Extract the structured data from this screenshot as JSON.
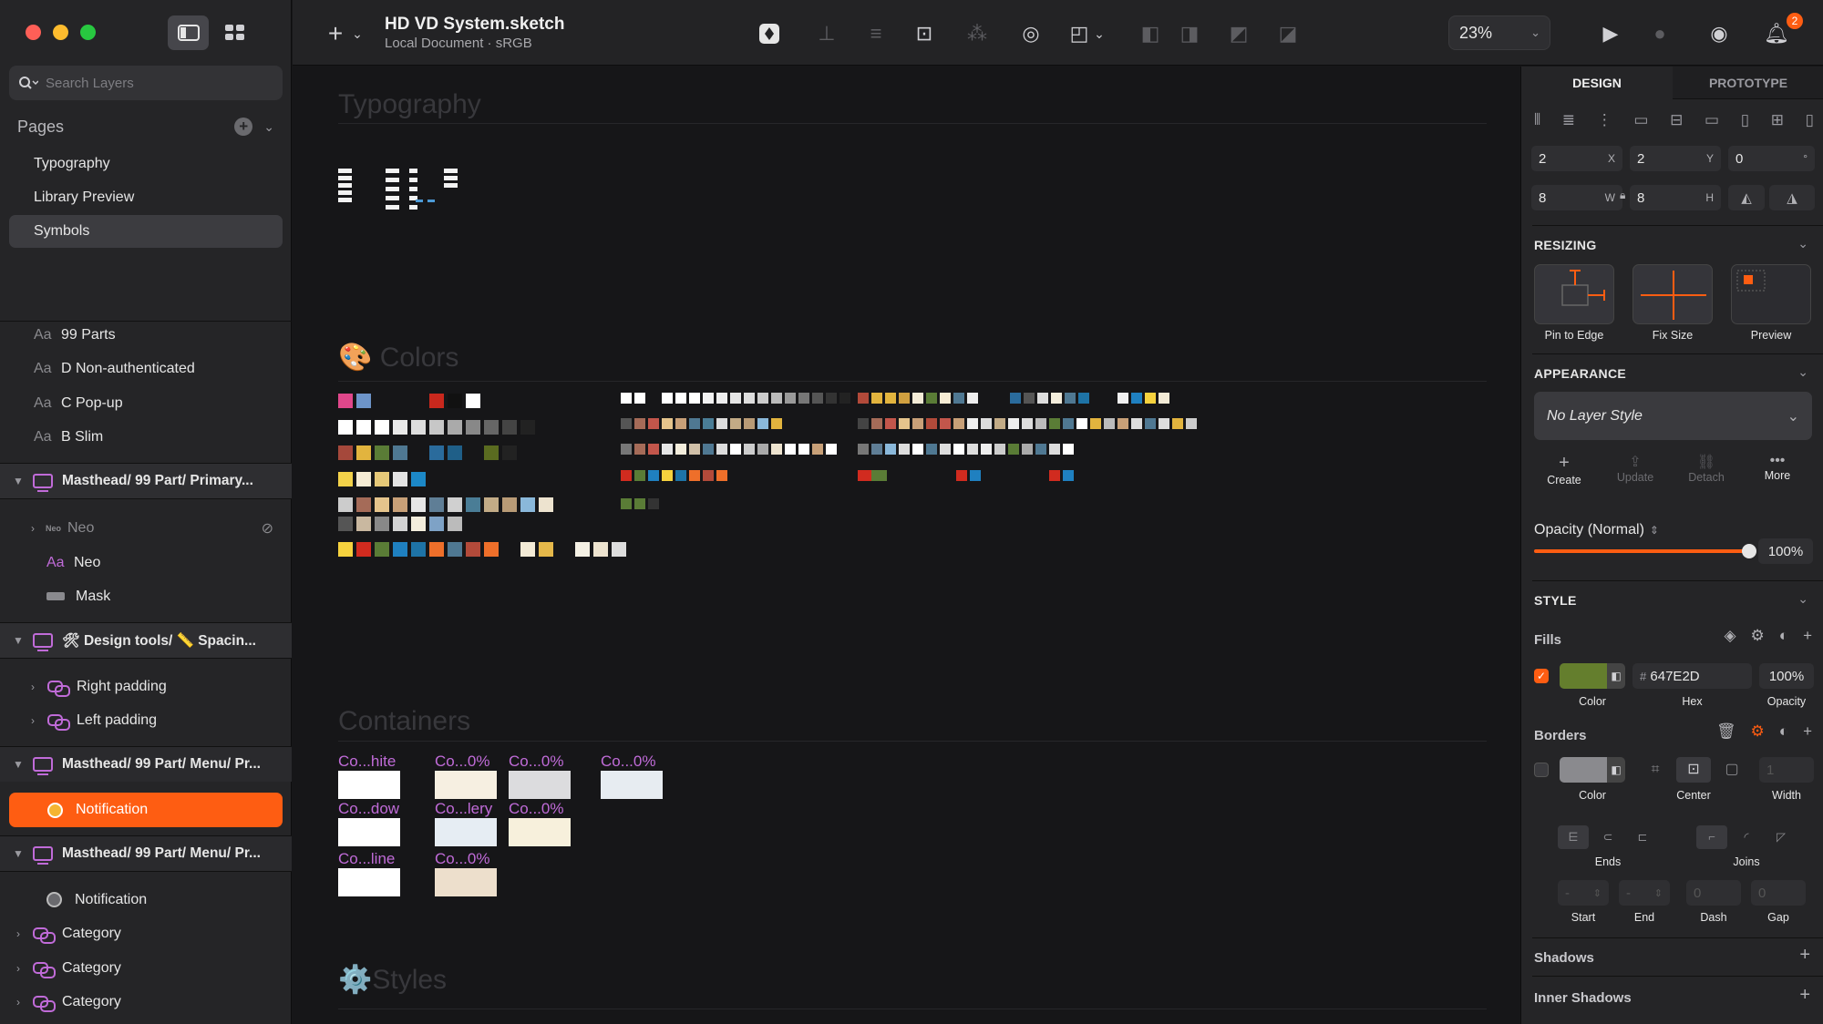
{
  "window": {
    "doc_title": "HD VD System.sketch",
    "doc_subtitle": "Local Document · sRGB",
    "zoom": "23%",
    "notification_count": "2"
  },
  "sidebar": {
    "search_placeholder": "Search Layers",
    "pages_label": "Pages",
    "pages": [
      "Typography",
      "Library Preview",
      "Symbols"
    ],
    "layers": [
      {
        "kind": "text",
        "label": "99 Parts",
        "prefix": "Aa"
      },
      {
        "kind": "text",
        "label": "D Non-authenticated",
        "prefix": "Aa"
      },
      {
        "kind": "text",
        "label": "C Pop-up",
        "prefix": "Aa"
      },
      {
        "kind": "text",
        "label": "B Slim",
        "prefix": "Aa"
      },
      {
        "kind": "artboard",
        "label": "Masthead/ 99 Part/ Primary..."
      },
      {
        "kind": "group",
        "label": "Neo"
      },
      {
        "kind": "text",
        "label": "Neo",
        "prefix": "Aa"
      },
      {
        "kind": "rect",
        "label": "Mask"
      },
      {
        "kind": "artboard",
        "label": "🛠 Design tools/ 📏 Spacin..."
      },
      {
        "kind": "symbol",
        "label": "Right padding"
      },
      {
        "kind": "symbol",
        "label": "Left padding"
      },
      {
        "kind": "artboard",
        "label": "Masthead/ 99 Part/ Menu/ Pr..."
      },
      {
        "kind": "selected",
        "label": "Notification"
      },
      {
        "kind": "artboard",
        "label": "Masthead/ 99 Part/ Menu/ Pr..."
      },
      {
        "kind": "oval",
        "label": "Notification"
      },
      {
        "kind": "symbol",
        "label": "Category"
      },
      {
        "kind": "symbol",
        "label": "Category"
      },
      {
        "kind": "symbol",
        "label": "Category"
      }
    ]
  },
  "canvas": {
    "sections": [
      "Typography",
      "🎨 Colors",
      "Containers",
      "⚙️Styles"
    ],
    "containers": [
      {
        "label": "Co...hite",
        "color": "#ffffff"
      },
      {
        "label": "Co...0%",
        "color": "#f6efe1"
      },
      {
        "label": "Co...0%",
        "color": "#dcdcde"
      },
      {
        "label": "Co...0%",
        "color": "#e7ecf1"
      },
      {
        "label": "Co...dow",
        "color": "#ffffff"
      },
      {
        "label": "Co...lery",
        "color": "#e6edf3"
      },
      {
        "label": "Co...0%",
        "color": "#f7f0dc"
      },
      {
        "label": "Co...line",
        "color": "#ffffff"
      },
      {
        "label": "Co...0%",
        "color": "#eddfcc"
      }
    ]
  },
  "inspector": {
    "tabs": [
      "DESIGN",
      "PROTOTYPE"
    ],
    "x": "2",
    "y": "2",
    "rotation": "0",
    "w": "8",
    "h": "8",
    "x_sfx": "X",
    "y_sfx": "Y",
    "rot_sfx": "°",
    "w_sfx": "W",
    "h_sfx": "H",
    "resizing": "RESIZING",
    "pin_to_edge": "Pin to Edge",
    "fix_size": "Fix Size",
    "preview": "Preview",
    "appearance": "APPEARANCE",
    "layer_style": "No Layer Style",
    "create": "Create",
    "update": "Update",
    "detach": "Detach",
    "more": "More",
    "opacity_label": "Opacity (Normal)",
    "opacity_value": "100%",
    "opacity_level": 1.0,
    "style": "STYLE",
    "fills": "Fills",
    "fill_hex": "647E2D",
    "fill_opacity": "100%",
    "fill_color": "#647E2D",
    "color_lbl": "Color",
    "hex_lbl": "Hex",
    "opacity_lbl": "Opacity",
    "borders": "Borders",
    "center_lbl": "Center",
    "width_lbl": "Width",
    "border_width": "1",
    "ends": "Ends",
    "joins": "Joins",
    "start": "Start",
    "end": "End",
    "dash": "Dash",
    "gap": "Gap",
    "dash_val": "0",
    "gap_val": "0",
    "shadows": "Shadows",
    "inner_shadows": "Inner Shadows"
  },
  "colors": {
    "accent": "#FE5D12",
    "symbol": "#C06BD8"
  }
}
